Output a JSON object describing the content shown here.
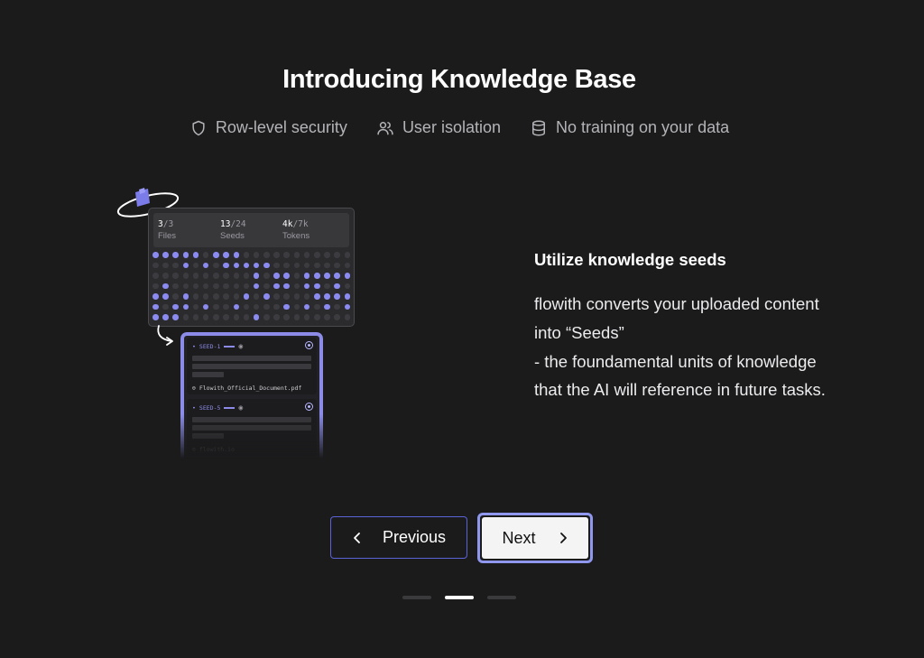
{
  "title": "Introducing Knowledge Base",
  "features": [
    {
      "icon": "shield-icon",
      "label": "Row-level security"
    },
    {
      "icon": "users-icon",
      "label": "User isolation"
    },
    {
      "icon": "database-icon",
      "label": "No training on your data"
    }
  ],
  "illustration": {
    "stats": [
      {
        "value": "3",
        "total": "/3",
        "label": "Files"
      },
      {
        "value": "13",
        "total": "/24",
        "label": "Seeds"
      },
      {
        "value": "4k",
        "total": "/7k",
        "label": "Tokens"
      }
    ],
    "seeds": [
      {
        "name": "SEED-1",
        "file": "Flowith_Official_Document.pdf"
      },
      {
        "name": "SEED-5",
        "file": "flowith.io"
      }
    ]
  },
  "content": {
    "heading": "Utilize knowledge seeds",
    "lines": [
      "flowith converts your uploaded content",
      "into “Seeds”",
      "- the foundamental units of knowledge",
      "that the AI will reference in future tasks."
    ]
  },
  "nav": {
    "previous_label": "Previous",
    "next_label": "Next"
  },
  "pager": {
    "total": 3,
    "current": 2
  },
  "colors": {
    "accent": "#8c8ce8",
    "background": "#1b1b1c",
    "prev_border": "#5b63d6"
  }
}
